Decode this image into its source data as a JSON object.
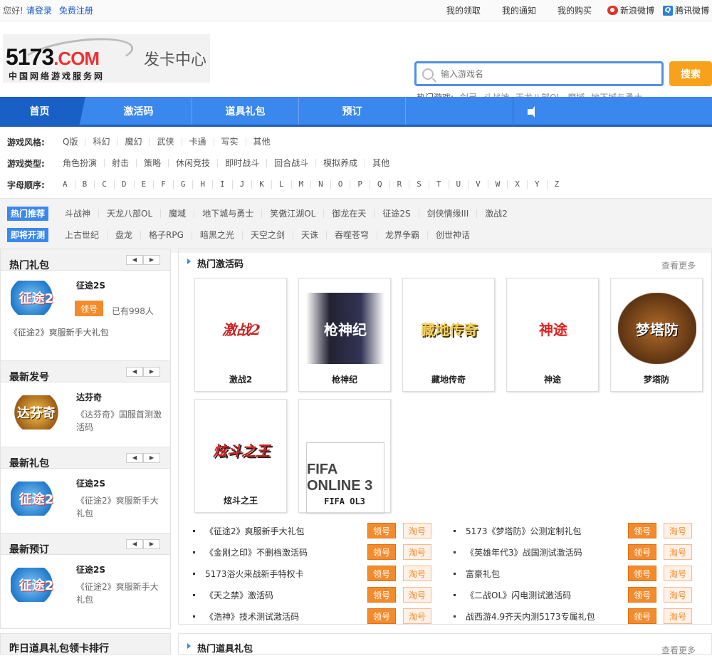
{
  "topbar": {
    "greeting": "您好!",
    "login": "请登录",
    "register": "免费注册",
    "links": [
      "我的领取",
      "我的通知",
      "我的购买"
    ],
    "weibo": "新浪微博",
    "tencent": "腾讯微博"
  },
  "logo": {
    "brand": "5173",
    "brand_com": ".COM",
    "subtitle": "中国网络游戏服务网",
    "section": "发卡中心"
  },
  "search": {
    "placeholder": "输入游戏名",
    "button": "搜索",
    "hot_label": "热门游戏:",
    "hot_items": [
      "剑灵",
      "斗战神",
      "天龙八部OL",
      "魔域",
      "地下城与勇士"
    ]
  },
  "nav": {
    "tabs": [
      "首页",
      "激活码",
      "道具礼包",
      "预订"
    ]
  },
  "filters": {
    "style_label": "游戏风格:",
    "styles": [
      "Q版",
      "科幻",
      "魔幻",
      "武侠",
      "卡通",
      "写实",
      "其他"
    ],
    "type_label": "游戏类型:",
    "types": [
      "角色扮演",
      "射击",
      "策略",
      "休闲竞技",
      "即时战斗",
      "回合战斗",
      "模拟养成",
      "其他"
    ],
    "letter_label": "字母顺序:",
    "letters": [
      "A",
      "B",
      "C",
      "D",
      "E",
      "F",
      "G",
      "H",
      "I",
      "J",
      "K",
      "L",
      "M",
      "N",
      "O",
      "P",
      "Q",
      "R",
      "S",
      "T",
      "U",
      "V",
      "W",
      "X",
      "Y",
      "Z"
    ]
  },
  "recommend": {
    "hot_badge": "热门推荐",
    "hot": [
      "斗战神",
      "天龙八部OL",
      "魔域",
      "地下城与勇士",
      "笑傲江湖OL",
      "御龙在天",
      "征途2S",
      "剑侠情缘III",
      "激战2"
    ],
    "soon_badge": "即将开测",
    "soon": [
      "上古世纪",
      "盘龙",
      "格子RPG",
      "暗黑之光",
      "天空之剑",
      "天诛",
      "吞噬苍穹",
      "龙界争霸",
      "创世神话"
    ]
  },
  "left": {
    "hot_gift": {
      "title": "热门礼包",
      "game": "征途2S",
      "claim": "领号",
      "count": "已有998人",
      "desc": "《征途2》爽服新手大礼包",
      "img": "征途2"
    },
    "new_code": {
      "title": "最新发号",
      "game": "达芬奇",
      "desc": "《达芬奇》国服首测激活码",
      "img": "达芬奇"
    },
    "new_gift": {
      "title": "最新礼包",
      "game": "征途2S",
      "desc": "《征途2》爽服新手大礼包",
      "img": "征途2"
    },
    "new_order": {
      "title": "最新预订",
      "game": "征途2S",
      "desc": "《征途2》爽服新手大礼包",
      "img": "征途2"
    },
    "rank_title": "昨日道具礼包领卡排行",
    "pager_prev": "◀",
    "pager_next": "▶"
  },
  "main": {
    "title": "热门激活码",
    "more": "查看更多",
    "cards": [
      {
        "name": "激战2",
        "art": "激战2"
      },
      {
        "name": "枪神纪",
        "art": "枪神纪"
      },
      {
        "name": "藏地传奇",
        "art": "藏地传奇"
      },
      {
        "name": "神途",
        "art": "神途"
      },
      {
        "name": "梦塔防",
        "art": "梦塔防"
      },
      {
        "name": "炫斗之王",
        "art": "炫斗之王"
      },
      {
        "name": "FIFA OL3",
        "art": "FIFA ONLINE 3"
      }
    ],
    "claim": "领号",
    "tao": "淘号",
    "left_list": [
      "《征途2》爽服新手大礼包",
      "《金刚之印》不删档激活码",
      "5173浴火来战新手特权卡",
      "《天之禁》激活码",
      "《浩神》技术测试激活码"
    ],
    "right_list": [
      "5173《梦塔防》公测定制礼包",
      "《英雄年代3》战国测试激活码",
      "富豪礼包",
      "《二战OL》闪电测试激活码",
      "战西游4.9齐天内测5173专属礼包"
    ]
  },
  "main2": {
    "title": "热门道具礼包",
    "more": "查看更多"
  }
}
